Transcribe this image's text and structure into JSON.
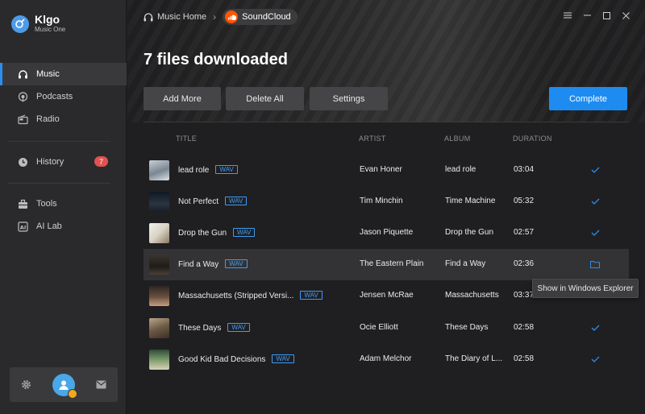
{
  "app": {
    "name": "Klgo",
    "subtitle": "Music One"
  },
  "sidebar": {
    "items": [
      {
        "label": "Music",
        "icon": "headphones-icon",
        "active": true
      },
      {
        "label": "Podcasts",
        "icon": "podcast-icon"
      },
      {
        "label": "Radio",
        "icon": "radio-icon"
      },
      {
        "label": "History",
        "icon": "clock-icon",
        "badge": "7"
      },
      {
        "label": "Tools",
        "icon": "toolbox-icon"
      },
      {
        "label": "AI Lab",
        "icon": "ai-icon"
      }
    ],
    "footer": {
      "settings_icon": "gear-icon",
      "avatar_icon": "user-icon",
      "mail_icon": "mail-icon"
    }
  },
  "breadcrumb": {
    "home": "Music Home",
    "current": "SoundCloud"
  },
  "window_controls": [
    "menu-icon",
    "minimize-icon",
    "maximize-icon",
    "close-icon"
  ],
  "main": {
    "headline": "7 files downloaded",
    "buttons": {
      "add_more": "Add More",
      "delete_all": "Delete All",
      "settings": "Settings",
      "complete": "Complete"
    },
    "columns": {
      "title": "TITLE",
      "artist": "ARTIST",
      "album": "ALBUM",
      "duration": "DURATION"
    },
    "tracks": [
      {
        "title": "lead role",
        "format": "WAV",
        "artist": "Evan Honer",
        "album": "lead role",
        "duration": "03:04",
        "status": "check"
      },
      {
        "title": "Not Perfect",
        "format": "WAV",
        "artist": "Tim Minchin",
        "album": "Time Machine",
        "duration": "05:32",
        "status": "check"
      },
      {
        "title": "Drop the Gun",
        "format": "WAV",
        "artist": "Jason Piquette",
        "album": "Drop the Gun",
        "duration": "02:57",
        "status": "check"
      },
      {
        "title": "Find a Way",
        "format": "WAV",
        "artist": "The Eastern Plain",
        "album": "Find a Way",
        "duration": "02:36",
        "status": "folder",
        "highlighted": true
      },
      {
        "title": "Massachusetts (Stripped Versi...",
        "format": "WAV",
        "artist": "Jensen McRae",
        "album": "Massachusetts",
        "duration": "03:37",
        "status": "none"
      },
      {
        "title": "These Days",
        "format": "WAV",
        "artist": "Ocie Elliott",
        "album": "These Days",
        "duration": "02:58",
        "status": "check"
      },
      {
        "title": "Good Kid Bad Decisions",
        "format": "WAV",
        "artist": "Adam Melchor",
        "album": "The Diary of L...",
        "duration": "02:58",
        "status": "check"
      }
    ],
    "tooltip": "Show in Windows Explorer"
  },
  "colors": {
    "accent": "#1e8bf0",
    "badge": "#e05252",
    "soundcloud": "#ff5500",
    "background": "#1f1f21",
    "sidebar": "#2a2a2c"
  }
}
